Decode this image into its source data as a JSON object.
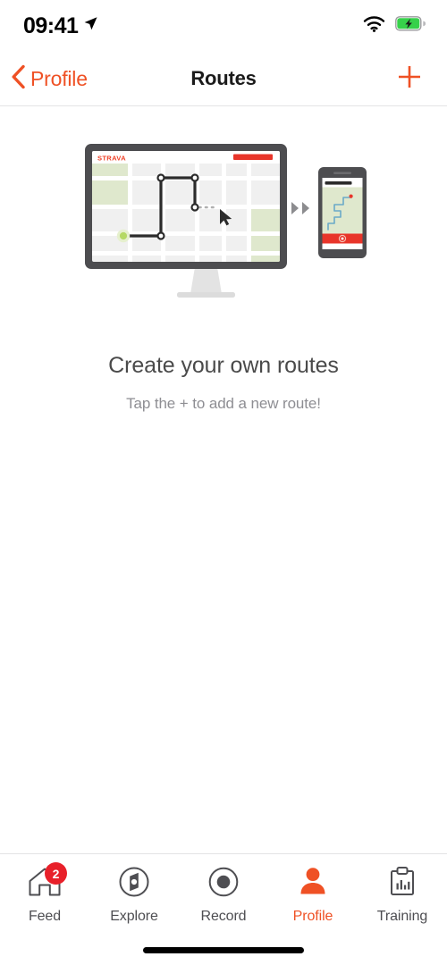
{
  "status_bar": {
    "time": "09:41",
    "location_icon": "location-arrow-icon",
    "wifi_icon": "wifi-icon",
    "battery_icon": "battery-charging-icon",
    "battery_color": "#36d14a"
  },
  "nav_bar": {
    "back_label": "Profile",
    "back_icon": "chevron-left-icon",
    "title": "Routes",
    "add_icon": "plus-icon",
    "accent_color": "#ef5125"
  },
  "illustration": {
    "name": "routes-empty-state-illustration",
    "monitor": {
      "brand_label": "STRAVA",
      "brand_color": "#ef3f25",
      "bezel_color": "#4d4d50",
      "map_background": "#f0f0f0",
      "park_color": "#dfe8cd",
      "road_color": "#ffffff",
      "route_color": "#2b2b2b",
      "start_marker_color": "#c3e068",
      "cursor_icon": "pointer-cursor-icon",
      "toolbar_button_color": "#e8352a"
    },
    "arrows": {
      "icon": "double-chevron-right-icon",
      "color": "#8c8c8f"
    },
    "mobile": {
      "body_color": "#4d4d50",
      "map_background": "#dfe8cd",
      "route_color": "#6aa9c8",
      "end_marker_color": "#e8352a",
      "action_bar_color": "#e8352a",
      "record_icon": "record-button-icon"
    }
  },
  "empty_state": {
    "title": "Create your own routes",
    "subtitle": "Tap the + to add a new route!"
  },
  "tab_bar": {
    "items": [
      {
        "label": "Feed",
        "icon": "home-icon",
        "badge": "2",
        "active": false
      },
      {
        "label": "Explore",
        "icon": "compass-icon",
        "badge": null,
        "active": false
      },
      {
        "label": "Record",
        "icon": "record-circle-icon",
        "badge": null,
        "active": false
      },
      {
        "label": "Profile",
        "icon": "person-icon",
        "badge": null,
        "active": true
      },
      {
        "label": "Training",
        "icon": "clipboard-chart-icon",
        "badge": null,
        "active": false
      }
    ],
    "badge_color": "#e8202a",
    "active_color": "#ef5125",
    "inactive_color": "#4e4e52"
  },
  "home_indicator": {
    "name": "home-indicator"
  }
}
